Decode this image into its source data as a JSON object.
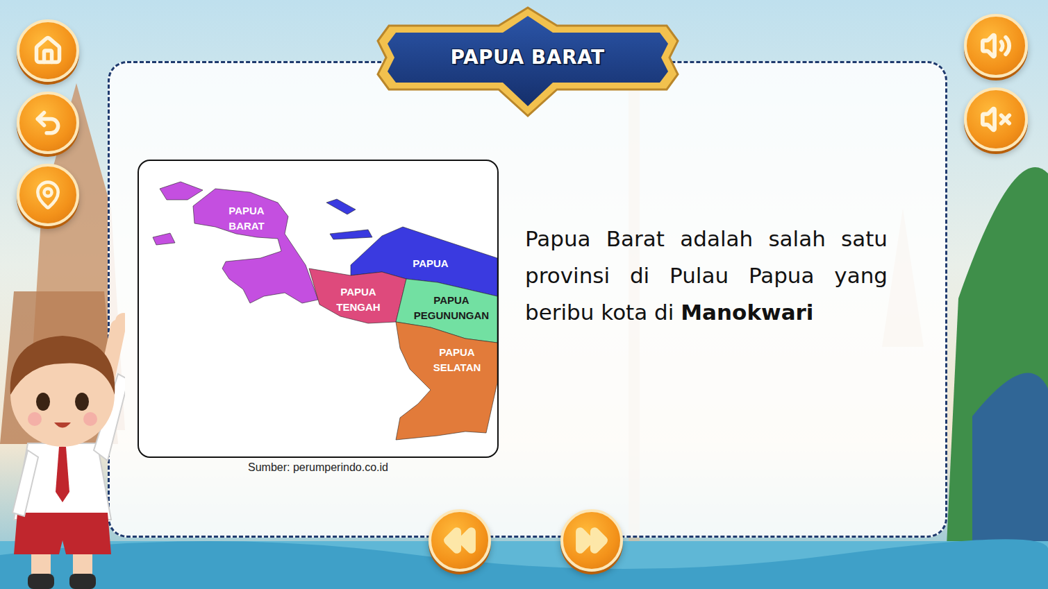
{
  "title": "PAPUA BARAT",
  "map": {
    "regions": [
      {
        "name": "PAPUA BARAT",
        "color": "#c44fe0"
      },
      {
        "name": "PAPUA",
        "color": "#3a3ae0"
      },
      {
        "name": "PAPUA TENGAH",
        "color": "#de4a7c"
      },
      {
        "name": "PAPUA PEGUNUNGAN",
        "color": "#72e0a2"
      },
      {
        "name": "PAPUA SELATAN",
        "color": "#e27b3a"
      }
    ],
    "source": "Sumber: perumperindo.co.id"
  },
  "description": {
    "text": "Papua Barat adalah salah satu provinsi di Pulau Papua yang beribu kota di",
    "highlight": "Manokwari"
  }
}
